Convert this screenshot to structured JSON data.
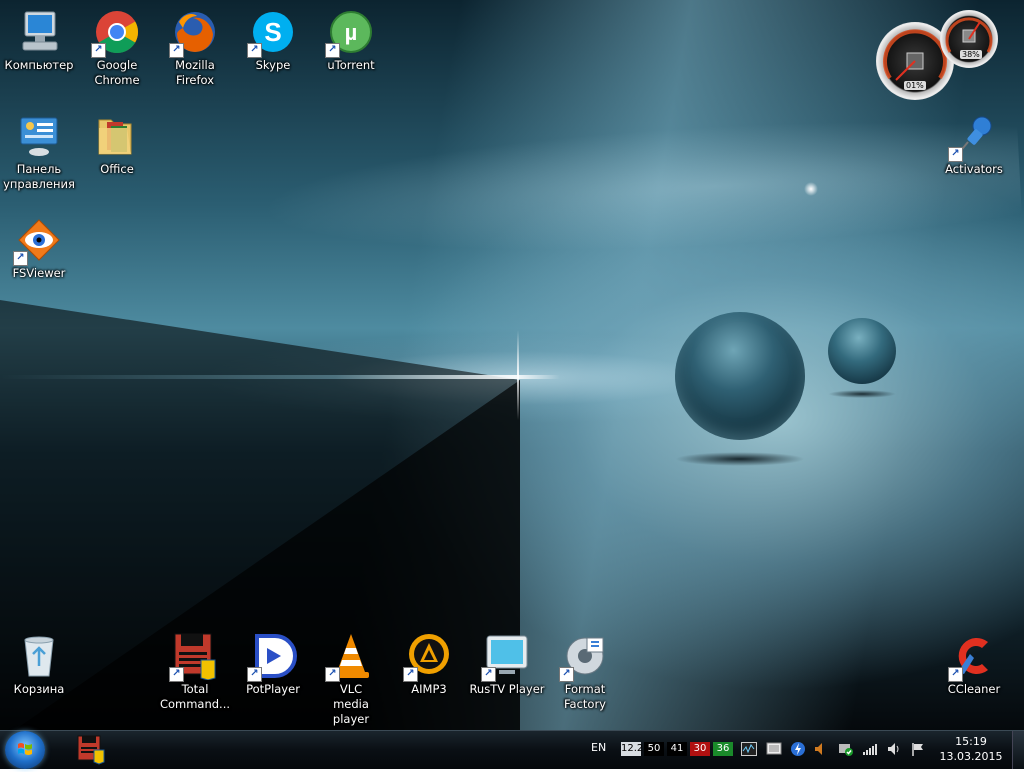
{
  "desktop_icons": {
    "computer": "Компьютер",
    "chrome": "Google Chrome",
    "firefox": "Mozilla Firefox",
    "skype": "Skype",
    "utorrent": "uTorrent",
    "control_panel": "Панель управления",
    "office": "Office",
    "fsviewer": "FSViewer",
    "activators": "Activators",
    "recycle_bin": "Корзина",
    "total_commander": "Total Command...",
    "potplayer": "PotPlayer",
    "vlc": "VLC media player",
    "aimp": "AIMP3",
    "rustv": "RusTV Player",
    "format_factory": "Format Factory",
    "ccleaner": "CCleaner"
  },
  "gadget": {
    "cpu_value": "01%",
    "memory_value": "38%"
  },
  "taskbar": {
    "language": "EN",
    "tray_numbers": [
      "12.2",
      "50",
      "41",
      "30",
      "36"
    ],
    "time": "15:19",
    "date": "13.03.2015"
  },
  "colors": {
    "taskbar": "#0a0f14",
    "tray_red": "#b01010",
    "tray_green": "#1a8a2a"
  }
}
